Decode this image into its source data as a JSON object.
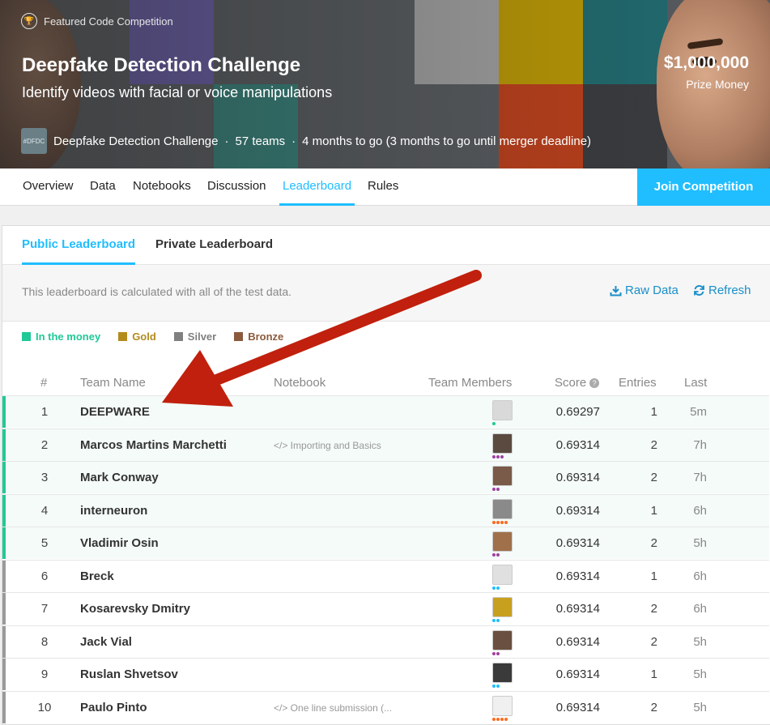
{
  "header": {
    "featured_label": "Featured Code Competition",
    "title": "Deepfake Detection Challenge",
    "subtitle": "Identify videos with facial or voice manipulations",
    "logo_text": "#DFDC",
    "meta_name": "Deepfake Detection Challenge",
    "meta_teams": "57 teams",
    "meta_deadline": "4 months to go (3 months to go until merger deadline)",
    "meta_sep": "·",
    "prize_amount": "$1,000,000",
    "prize_label": "Prize Money"
  },
  "nav": {
    "tabs": [
      "Overview",
      "Data",
      "Notebooks",
      "Discussion",
      "Leaderboard",
      "Rules"
    ],
    "active": "Leaderboard",
    "join_label": "Join Competition"
  },
  "leaderboard": {
    "tabs": [
      "Public Leaderboard",
      "Private Leaderboard"
    ],
    "info_text": "This leaderboard is calculated with all of the test data.",
    "raw_data_label": "Raw Data",
    "refresh_label": "Refresh",
    "legend": [
      {
        "label": "In the money",
        "color": "#20c997"
      },
      {
        "label": "Gold",
        "color": "#b38b1d"
      },
      {
        "label": "Silver",
        "color": "#808080"
      },
      {
        "label": "Bronze",
        "color": "#8b5a3c"
      }
    ],
    "columns": [
      "#",
      "Team Name",
      "Notebook",
      "Team Members",
      "Score",
      "Entries",
      "Last"
    ],
    "rows": [
      {
        "rank": "1",
        "team": "DEEPWARE",
        "notebook": "",
        "score": "0.69297",
        "entries": "1",
        "last": "5m",
        "money": true
      },
      {
        "rank": "2",
        "team": "Marcos Martins Marchetti",
        "notebook": "</> Importing and Basics",
        "score": "0.69314",
        "entries": "2",
        "last": "7h",
        "money": true
      },
      {
        "rank": "3",
        "team": "Mark Conway",
        "notebook": "",
        "score": "0.69314",
        "entries": "2",
        "last": "7h",
        "money": true
      },
      {
        "rank": "4",
        "team": "interneuron",
        "notebook": "",
        "score": "0.69314",
        "entries": "1",
        "last": "6h",
        "money": true
      },
      {
        "rank": "5",
        "team": "Vladimir Osin",
        "notebook": "",
        "score": "0.69314",
        "entries": "2",
        "last": "5h",
        "money": true
      },
      {
        "rank": "6",
        "team": "Breck",
        "notebook": "",
        "score": "0.69314",
        "entries": "1",
        "last": "6h",
        "money": false
      },
      {
        "rank": "7",
        "team": "Kosarevsky Dmitry",
        "notebook": "",
        "score": "0.69314",
        "entries": "2",
        "last": "6h",
        "money": false
      },
      {
        "rank": "8",
        "team": "Jack Vial",
        "notebook": "",
        "score": "0.69314",
        "entries": "2",
        "last": "5h",
        "money": false
      },
      {
        "rank": "9",
        "team": "Ruslan Shvetsov",
        "notebook": "",
        "score": "0.69314",
        "entries": "1",
        "last": "5h",
        "money": false
      },
      {
        "rank": "10",
        "team": "Paulo Pinto",
        "notebook": "</> One line submission (...",
        "score": "0.69314",
        "entries": "2",
        "last": "5h",
        "money": false
      }
    ]
  },
  "colors": {
    "accent": "#20beff",
    "money_bar": "#20c997",
    "annotation_arrow": "#c0200d"
  }
}
